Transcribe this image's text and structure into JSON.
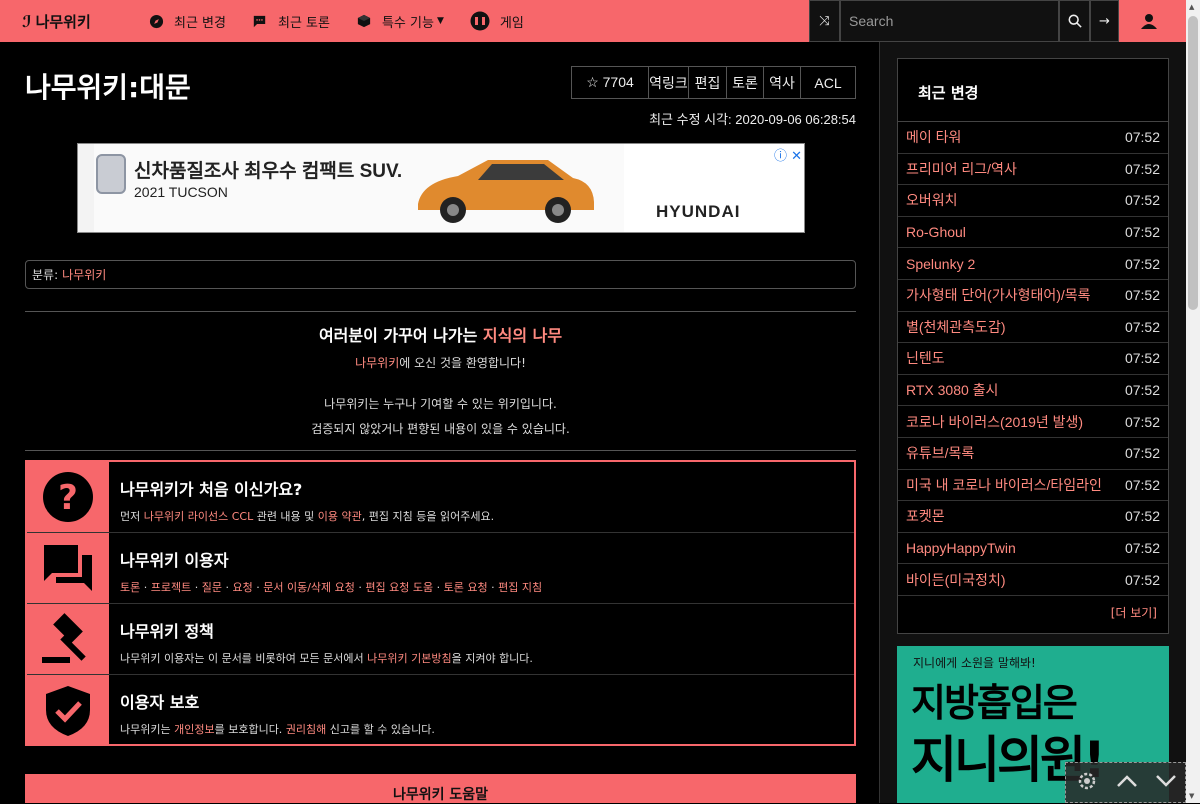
{
  "nav": {
    "logo": "나무위키",
    "items": [
      {
        "label": "최근 변경",
        "icon": "compass-icon"
      },
      {
        "label": "최근 토론",
        "icon": "comment-icon"
      },
      {
        "label": "특수 기능",
        "icon": "cube-icon"
      },
      {
        "label": "게임",
        "icon": "gamepad-icon"
      }
    ],
    "search_placeholder": "Search"
  },
  "page": {
    "title": "나무위키:대문",
    "star_count": "☆ 7704",
    "toolbar": [
      "역링크",
      "편집",
      "토론",
      "역사",
      "ACL"
    ],
    "last_modified": "최근 수정 시각: 2020-09-06 06:28:54"
  },
  "ad": {
    "headline": "신차품질조사 최우수 컴팩트 SUV.",
    "sub": "2021 TUCSON",
    "brand": "HYUNDAI",
    "close": "ⓘ ✕"
  },
  "category": {
    "prefix": "분류:",
    "link": "나무위키"
  },
  "notice": {
    "line1_text": "여러분이 가꾸어 나가는 ",
    "line1_accent": "지식의 나무",
    "line2_accent": "나무위키",
    "line2_text": "에 오신 것을 환영합니다!",
    "line3": "나무위키는 누구나 기여할 수 있는 위키입니다.",
    "line4": "검증되지 않았거나 편향된 내용이 있을 수 있습니다."
  },
  "guide": [
    {
      "icon": "question-icon",
      "title": "나무위키가 처음 이신가요?",
      "pre": "먼저 ",
      "link1": "나무위키 라이선스 CCL",
      "mid": " 관련 내용 및 ",
      "link2": "이용 약관",
      "post": ", 편집 지침 등을 읽어주세요."
    },
    {
      "icon": "forum-icon",
      "title": "나무위키 이용자",
      "links": [
        "토론",
        "프로젝트",
        "질문",
        "요청",
        "문서 이동/삭제 요청",
        "편집 요청 도움",
        "토론 요청",
        "편집 지침"
      ]
    },
    {
      "icon": "gavel-icon",
      "title": "나무위키 정책",
      "pre": "나무위키 이용자는 이 문서를 비롯하여 모든 문서에서 ",
      "link1": "나무위키 기본방침",
      "post": "을 지켜야 합니다."
    },
    {
      "icon": "shield-icon",
      "title": "이용자 보호",
      "pre": "나무위키는 ",
      "link1": "개인정보",
      "mid": "를 보호합니다. ",
      "link2": "권리침해",
      "post": " 신고를 할 수 있습니다."
    }
  ],
  "bottom_button": "나무위키 도움말",
  "recent": {
    "title": "최근 변경",
    "items": [
      {
        "title": "메이 타워",
        "time": "07:52"
      },
      {
        "title": "프리미어 리그/역사",
        "time": "07:52"
      },
      {
        "title": "오버워치",
        "time": "07:52"
      },
      {
        "title": "Ro-Ghoul",
        "time": "07:52"
      },
      {
        "title": "Spelunky 2",
        "time": "07:52"
      },
      {
        "title": "가사형태 단어(가사형태어)/목록",
        "time": "07:52"
      },
      {
        "title": "별(천체관측도감)",
        "time": "07:52"
      },
      {
        "title": "닌텐도",
        "time": "07:52"
      },
      {
        "title": "RTX 3080 출시",
        "time": "07:52"
      },
      {
        "title": "코로나 바이러스(2019년 발생)",
        "time": "07:52"
      },
      {
        "title": "유튜브/목록",
        "time": "07:52"
      },
      {
        "title": "미국 내 코로나 바이러스/타임라인",
        "time": "07:52"
      },
      {
        "title": "포켓몬",
        "time": "07:52"
      },
      {
        "title": "HappyHappyTwin",
        "time": "07:52"
      },
      {
        "title": "바이든(미국정치)",
        "time": "07:52"
      }
    ],
    "more": "[더 보기]"
  },
  "side_ad": {
    "line1": "지니에게 소원을 말해봐!",
    "line2": "지방흡입은",
    "line3": "지니의원!"
  },
  "colors": {
    "accent": "#f7676b",
    "link": "#ff8a80",
    "bg": "#000000"
  }
}
